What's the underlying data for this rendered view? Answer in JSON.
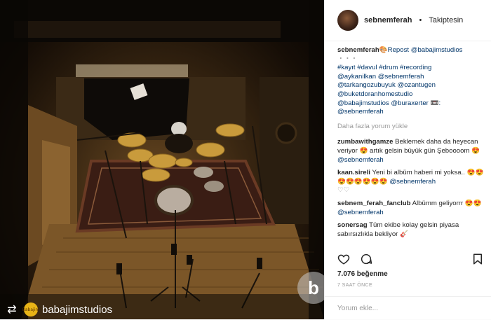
{
  "photo": {
    "repost_handle": "babajimstudios",
    "avatar_text": "Babajim",
    "watermark": "b"
  },
  "header": {
    "username": "sebnemferah",
    "separator": "•",
    "follow_status": "Takiptesin"
  },
  "caption": {
    "username": "sebnemferah",
    "emoji": "🎨",
    "repost_text": "Repost @babajimstudios",
    "dots": "・・・",
    "lines": [
      "#kayıt #davul #drum #recording",
      "@aykanilkan @sebnemferah",
      "@tarkangozubuyuk @ozantugen",
      "@buketdoranhomestudio",
      "@babajimstudios @buraxerter 📼:",
      "@sebnemferah"
    ]
  },
  "load_more": "Daha fazla yorum yükle",
  "comments": [
    {
      "user": "zumbawithgamze",
      "text": "Beklemek daha da heyecan veriyor 😍 artık gelsin büyük gün Şeboooom 😍",
      "mention": "@sebnemferah"
    },
    {
      "user": "kaan.sireli",
      "text": "Yeni bi albüm haberi mi yoksa.. 😍😍😍😍😍😍😍😍",
      "mention": "@sebnemferah",
      "extra": "♡♡"
    },
    {
      "user": "sebnem_ferah_fanclub",
      "text": "Albümm geliyorrr 😍😍",
      "mention": "@sebnemferah"
    },
    {
      "user": "sonersag",
      "text": "Tüm ekibe kolay gelsin piyasa sabırsızlıkla bekliyor 🎸"
    }
  ],
  "likes": "7.076 beğenme",
  "time_ago": "7 SAAT ÖNCE",
  "comment_placeholder": "Yorum ekle...",
  "icons": {
    "like": "heart-icon",
    "comment": "comment-icon",
    "bookmark": "bookmark-icon",
    "repost": "repost-icon"
  }
}
